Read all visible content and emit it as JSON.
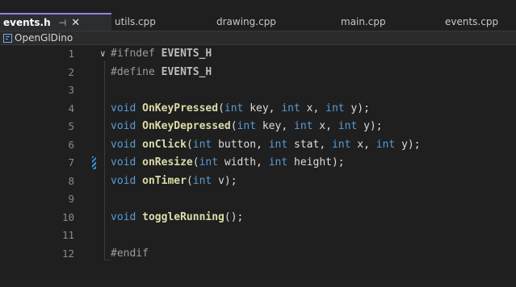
{
  "tabs": [
    {
      "label": "events.h",
      "active": true,
      "pin": "⊣",
      "close": "✕"
    },
    {
      "label": "utils.cpp"
    },
    {
      "label": "drawing.cpp"
    },
    {
      "label": "main.cpp"
    },
    {
      "label": "events.cpp"
    }
  ],
  "project": {
    "name": "OpenGlDino"
  },
  "colors": {
    "accent": "#9183e6",
    "keyword": "#569cd6",
    "function": "#dcdcaa",
    "linenumber": "#8a8a8a",
    "change_marker": "#3a96dd"
  },
  "editor": {
    "fold_icon": "∨",
    "lines": [
      {
        "n": "1",
        "tokens": [
          {
            "t": "#ifndef ",
            "c": "pp"
          },
          {
            "t": "EVENTS_H",
            "c": "macro"
          }
        ]
      },
      {
        "n": "2",
        "tokens": [
          {
            "t": "#define ",
            "c": "pp"
          },
          {
            "t": "EVENTS_H",
            "c": "macro"
          }
        ]
      },
      {
        "n": "3",
        "tokens": []
      },
      {
        "n": "4",
        "tokens": [
          {
            "t": "void ",
            "c": "kw"
          },
          {
            "t": "OnKeyPressed",
            "c": "fn"
          },
          {
            "t": "(",
            "c": "txt"
          },
          {
            "t": "int",
            "c": "kw"
          },
          {
            "t": " key, ",
            "c": "txt"
          },
          {
            "t": "int",
            "c": "kw"
          },
          {
            "t": " x, ",
            "c": "txt"
          },
          {
            "t": "int",
            "c": "kw"
          },
          {
            "t": " y);",
            "c": "txt"
          }
        ]
      },
      {
        "n": "5",
        "tokens": [
          {
            "t": "void ",
            "c": "kw"
          },
          {
            "t": "OnKeyDepressed",
            "c": "fn"
          },
          {
            "t": "(",
            "c": "txt"
          },
          {
            "t": "int",
            "c": "kw"
          },
          {
            "t": " key, ",
            "c": "txt"
          },
          {
            "t": "int",
            "c": "kw"
          },
          {
            "t": " x, ",
            "c": "txt"
          },
          {
            "t": "int",
            "c": "kw"
          },
          {
            "t": " y);",
            "c": "txt"
          }
        ]
      },
      {
        "n": "6",
        "tokens": [
          {
            "t": "void ",
            "c": "kw"
          },
          {
            "t": "onClick",
            "c": "fn"
          },
          {
            "t": "(",
            "c": "txt"
          },
          {
            "t": "int",
            "c": "kw"
          },
          {
            "t": " button, ",
            "c": "txt"
          },
          {
            "t": "int",
            "c": "kw"
          },
          {
            "t": " stat, ",
            "c": "txt"
          },
          {
            "t": "int",
            "c": "kw"
          },
          {
            "t": " x, ",
            "c": "txt"
          },
          {
            "t": "int",
            "c": "kw"
          },
          {
            "t": " y);",
            "c": "txt"
          }
        ]
      },
      {
        "n": "7",
        "marker": true,
        "tokens": [
          {
            "t": "void ",
            "c": "kw"
          },
          {
            "t": "onResize",
            "c": "fn"
          },
          {
            "t": "(",
            "c": "txt"
          },
          {
            "t": "int",
            "c": "kw"
          },
          {
            "t": " width, ",
            "c": "txt"
          },
          {
            "t": "int",
            "c": "kw"
          },
          {
            "t": " height);",
            "c": "txt"
          }
        ]
      },
      {
        "n": "8",
        "tokens": [
          {
            "t": "void ",
            "c": "kw"
          },
          {
            "t": "onTimer",
            "c": "fn"
          },
          {
            "t": "(",
            "c": "txt"
          },
          {
            "t": "int",
            "c": "kw"
          },
          {
            "t": " v);",
            "c": "txt"
          }
        ]
      },
      {
        "n": "9",
        "tokens": []
      },
      {
        "n": "10",
        "tokens": [
          {
            "t": "void ",
            "c": "kw"
          },
          {
            "t": "toggleRunning",
            "c": "fn"
          },
          {
            "t": "();",
            "c": "txt"
          }
        ]
      },
      {
        "n": "11",
        "tokens": []
      },
      {
        "n": "12",
        "tokens": [
          {
            "t": "#endif",
            "c": "pp"
          }
        ]
      }
    ]
  }
}
